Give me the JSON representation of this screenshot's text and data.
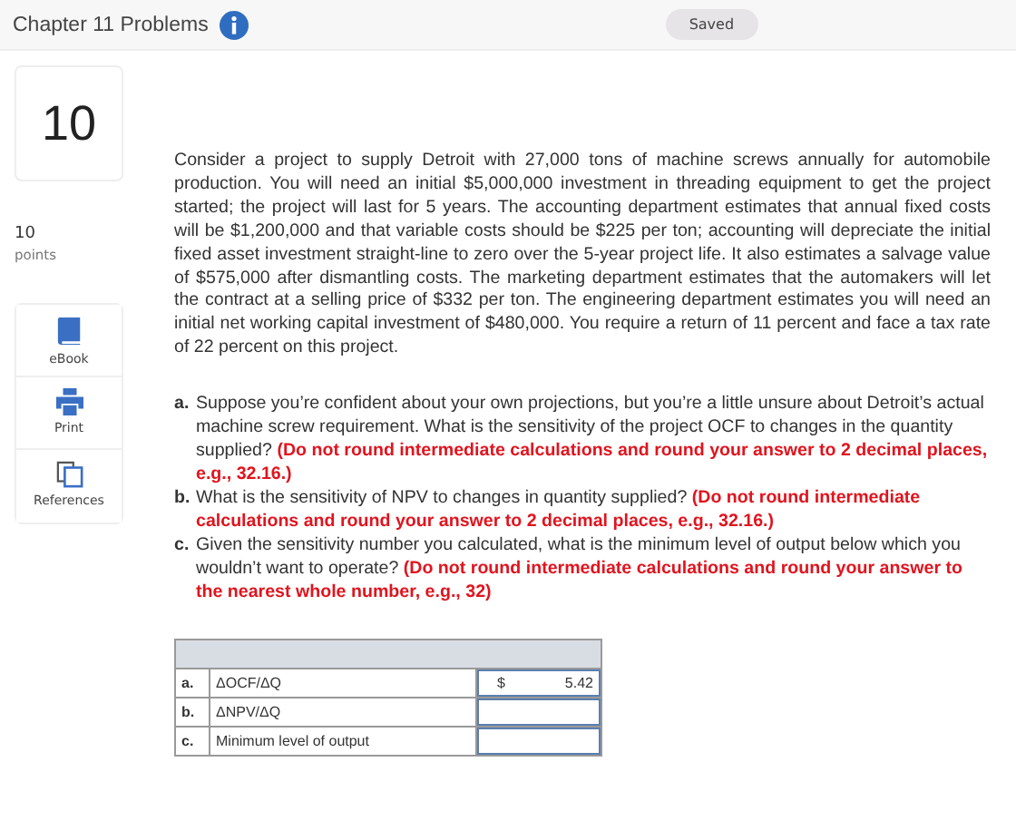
{
  "header": {
    "title": "Chapter 11 Problems",
    "status": "Saved"
  },
  "question_number": "10",
  "points": {
    "value": "10",
    "label": "points"
  },
  "tools": [
    {
      "kind": "ebook",
      "label": "eBook"
    },
    {
      "kind": "print",
      "label": "Print"
    },
    {
      "kind": "references",
      "label": "References"
    }
  ],
  "problem_text": "Consider a project to supply Detroit with 27,000 tons of machine screws annually for automobile production. You will need an initial $5,000,000 investment in threading equipment to get the project started; the project will last for 5 years. The accounting department estimates that annual fixed costs will be $1,200,000 and that variable costs should be $225 per ton; accounting will depreciate the initial fixed asset investment straight-line to zero over the 5-year project life. It also estimates a salvage value of $575,000 after dismantling costs. The marketing department estimates that the automakers will let the contract at a selling price of $332 per ton. The engineering department estimates you will need an initial net working capital investment of $480,000. You require a return of 11 percent and face a tax rate of 22 percent on this project.",
  "questions": [
    {
      "letter": "a.",
      "text": "Suppose you’re confident about your own projections, but you’re a little unsure about Detroit’s actual machine screw requirement. What is the sensitivity of the project OCF to changes in the quantity supplied?",
      "note": "(Do not round intermediate calculations and round your answer to 2 decimal places, e.g., 32.16.)"
    },
    {
      "letter": "b.",
      "text": "What is the sensitivity of NPV to changes in quantity supplied?",
      "note": "(Do not round intermediate calculations and round your answer to 2 decimal places, e.g., 32.16.)"
    },
    {
      "letter": "c.",
      "text": "Given the sensitivity number you calculated, what is the minimum level of output below which you wouldn’t want to operate?",
      "note": "(Do not round intermediate calculations and round your answer to the nearest whole number, e.g., 32)"
    }
  ],
  "answer_table": {
    "rows": [
      {
        "letter": "a.",
        "label": "ΔOCF/ΔQ",
        "currency": "$",
        "value": "5.42"
      },
      {
        "letter": "b.",
        "label": "ΔNPV/ΔQ"
      },
      {
        "letter": "c.",
        "label": "Minimum level of output"
      }
    ]
  }
}
